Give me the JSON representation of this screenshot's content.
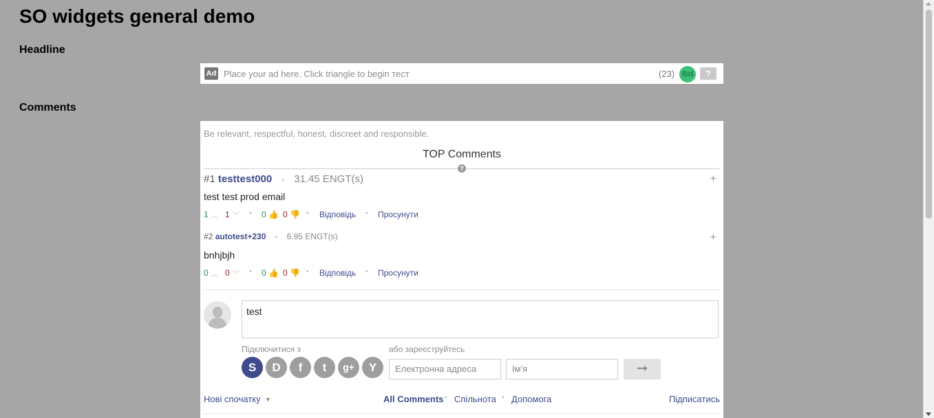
{
  "page": {
    "title": "SO widgets general demo",
    "headline_heading": "Headline",
    "comments_heading": "Comments"
  },
  "adbar": {
    "badge": "Ad",
    "placeholder": "Place your ad here. Click triangle to begin тест",
    "count": "(23)",
    "bid_label": "Bid",
    "help_label": "?"
  },
  "comments": {
    "rules_text": "Be relevant, respectful, honest, discreet and responsible.",
    "top_title": "TOP Comments",
    "help_icon_label": "?",
    "items": [
      {
        "rank": "#1",
        "author": "testtest000",
        "amount": "31.45 ENGT(s)",
        "text": "test test prod email",
        "up": "1",
        "down": "1",
        "likes": "0",
        "dislikes": "0",
        "reply": "Відповідь",
        "promote": "Просунути",
        "expand": "+"
      },
      {
        "rank": "#2",
        "author": "autotest+230",
        "amount": "6.95 ENGT(s)",
        "text": "bnhjbjh",
        "up": "0",
        "down": "0",
        "likes": "0",
        "dislikes": "0",
        "reply": "Відповідь",
        "promote": "Просунути",
        "expand": "+"
      }
    ],
    "composer_value": "test",
    "connect_label": "Підключитися з",
    "register_label": "або зареєструйтесь",
    "social_icons": [
      "so-icon",
      "disqus-icon",
      "facebook-icon",
      "twitter-icon",
      "google-plus-icon",
      "yahoo-icon"
    ],
    "social_glyphs": [
      "S",
      "D",
      "f",
      "t",
      "g+",
      "Y"
    ],
    "email_placeholder": "Електронна адреса",
    "name_placeholder": "Ім'я",
    "send_glyph": "➞",
    "footer": {
      "sort": "Нові спочатку",
      "caret": "▼",
      "all_comments": "All Comments",
      "community": "Спільнота",
      "help": "Допомога",
      "subscribe": "Підписатись"
    }
  },
  "colors": {
    "background": "#a6a6a6",
    "link": "#404b8c",
    "bid": "#3cc077",
    "upvote": "#2f8a3f",
    "downvote": "#9b1c1c"
  }
}
